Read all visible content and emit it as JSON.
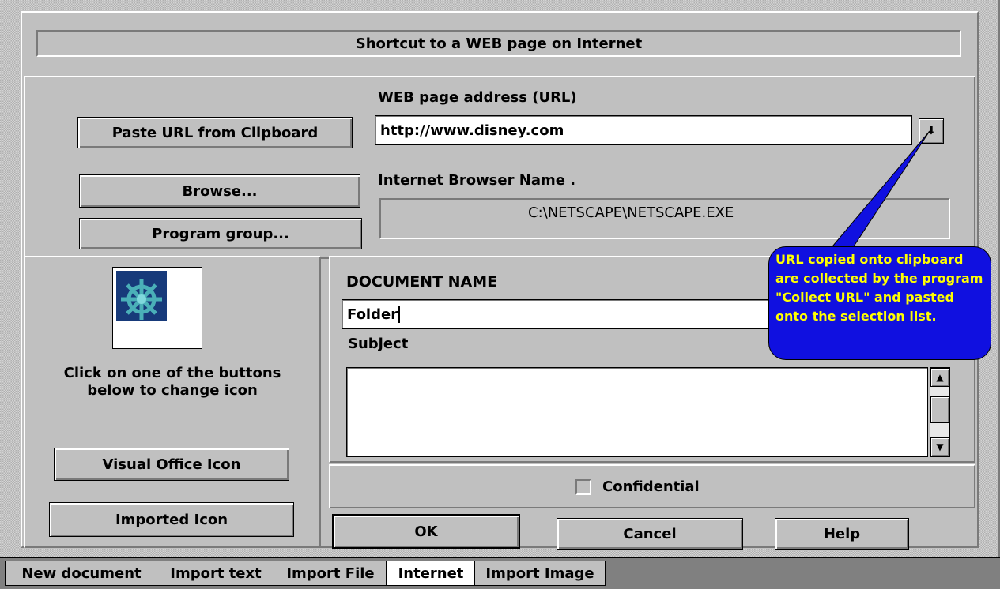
{
  "dialog": {
    "title": "Shortcut to a WEB page on Internet"
  },
  "url_section": {
    "url_label": "WEB page address (URL)",
    "url_value": "http://www.disney.com",
    "dropdown_glyph": "⬇",
    "paste_button": "Paste URL from Clipboard",
    "browse_button": "Browse...",
    "program_group_button": "Program group...",
    "browser_label": "Internet Browser Name .",
    "browser_path": "C:\\NETSCAPE\\NETSCAPE.EXE"
  },
  "callout": {
    "text": "URL copied onto clipboard are collected by the program \"Collect URL\" and pasted onto the selection list.",
    "background": "#1010e0",
    "text_color": "#ffff00"
  },
  "icon_section": {
    "icon_name": "ship-wheel-icon",
    "instructions": "Click on one of the buttons below to change icon",
    "visual_office_button": "Visual Office Icon",
    "imported_button": "Imported Icon"
  },
  "document": {
    "name_label": "DOCUMENT NAME",
    "name_value": "Folder",
    "subject_label": "Subject",
    "subject_value": "",
    "confidential_label": "Confidential",
    "confidential_checked": false
  },
  "buttons": {
    "ok": "OK",
    "cancel": "Cancel",
    "help": "Help"
  },
  "tabs": [
    {
      "label": "New document",
      "active": false
    },
    {
      "label": "Import text",
      "active": false
    },
    {
      "label": "Import File",
      "active": false
    },
    {
      "label": "Internet",
      "active": true
    },
    {
      "label": "Import Image",
      "active": false
    }
  ]
}
